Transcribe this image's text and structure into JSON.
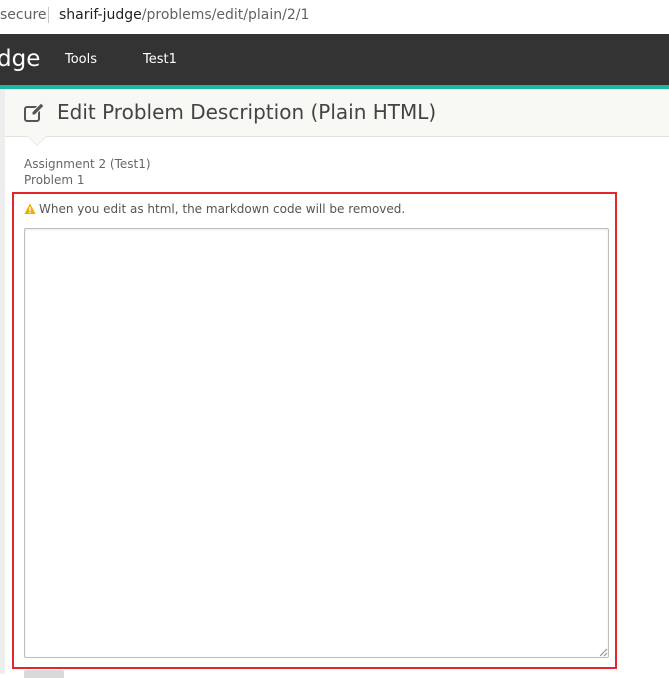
{
  "browser": {
    "secure_label": "secure",
    "host": "sharif-judge",
    "path": "/problems/edit/plain/2/1"
  },
  "navbar": {
    "brand": "ge",
    "brand_prefix": "d",
    "items": [
      {
        "label": "Tools"
      },
      {
        "label": "Test1"
      }
    ],
    "background": "#333333",
    "accent": "#1fb5a0"
  },
  "header": {
    "icon": "edit-icon",
    "title": "Edit Problem Description (Plain HTML)"
  },
  "context": {
    "assignment": "Assignment 2 (Test1)",
    "problem": "Problem 1"
  },
  "warning": {
    "icon": "warning-icon",
    "text": "When you edit as html, the markdown code will be removed.",
    "color": "#f0ad00"
  },
  "editor": {
    "value": ""
  },
  "highlight": {
    "color": "#e3262c"
  }
}
